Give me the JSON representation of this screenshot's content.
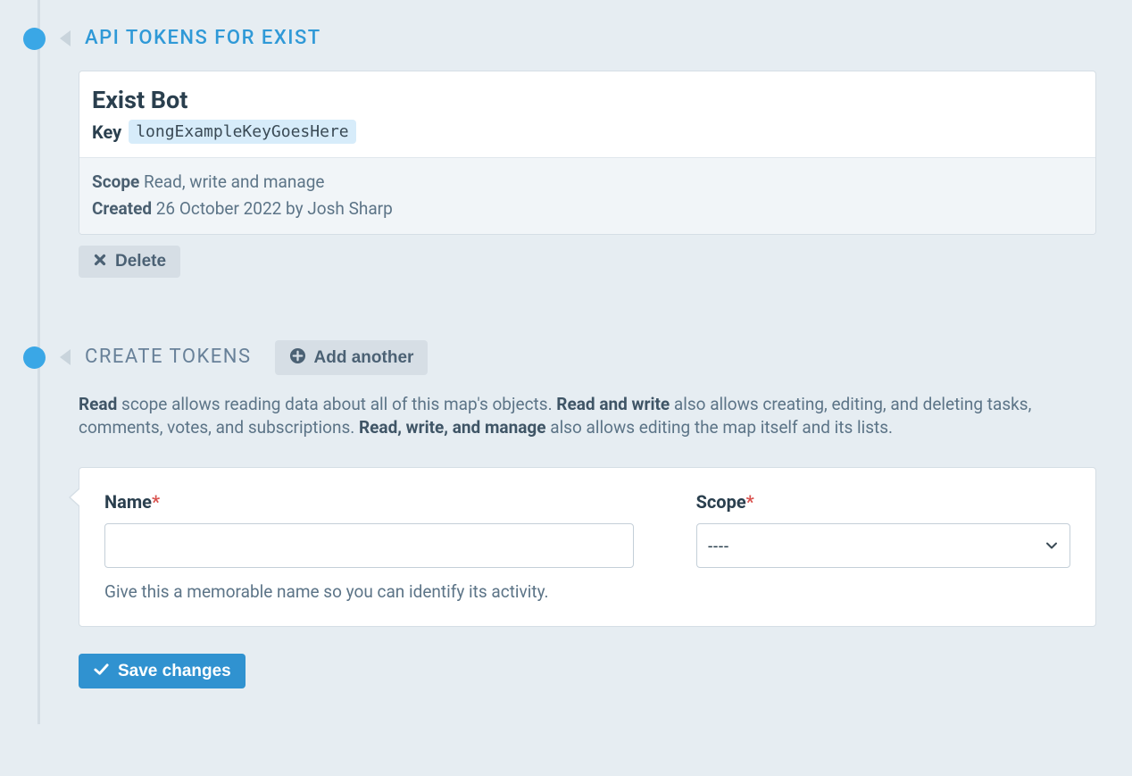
{
  "sections": {
    "tokens": {
      "title": "API TOKENS FOR EXIST"
    },
    "create": {
      "title": "CREATE TOKENS",
      "add_another_label": "Add another"
    }
  },
  "token": {
    "name": "Exist Bot",
    "key_label": "Key",
    "key_value": "longExampleKeyGoesHere",
    "scope_label": "Scope",
    "scope_value": "Read, write and manage",
    "created_label": "Created",
    "created_value": "26 October 2022 by Josh Sharp",
    "delete_label": "Delete"
  },
  "scope_help": {
    "read_bold": "Read",
    "read_text": " scope allows reading data about all of this map's objects. ",
    "rw_bold": "Read and write",
    "rw_text": " also allows creating, editing, and deleting tasks, comments, votes, and subscriptions. ",
    "rwm_bold": "Read, write, and manage",
    "rwm_text": " also allows editing the map itself and its lists."
  },
  "form": {
    "name_label": "Name",
    "scope_label": "Scope",
    "scope_placeholder": "----",
    "name_value": "",
    "name_help": "Give this a memorable name so you can identify its activity.",
    "save_label": "Save changes"
  }
}
